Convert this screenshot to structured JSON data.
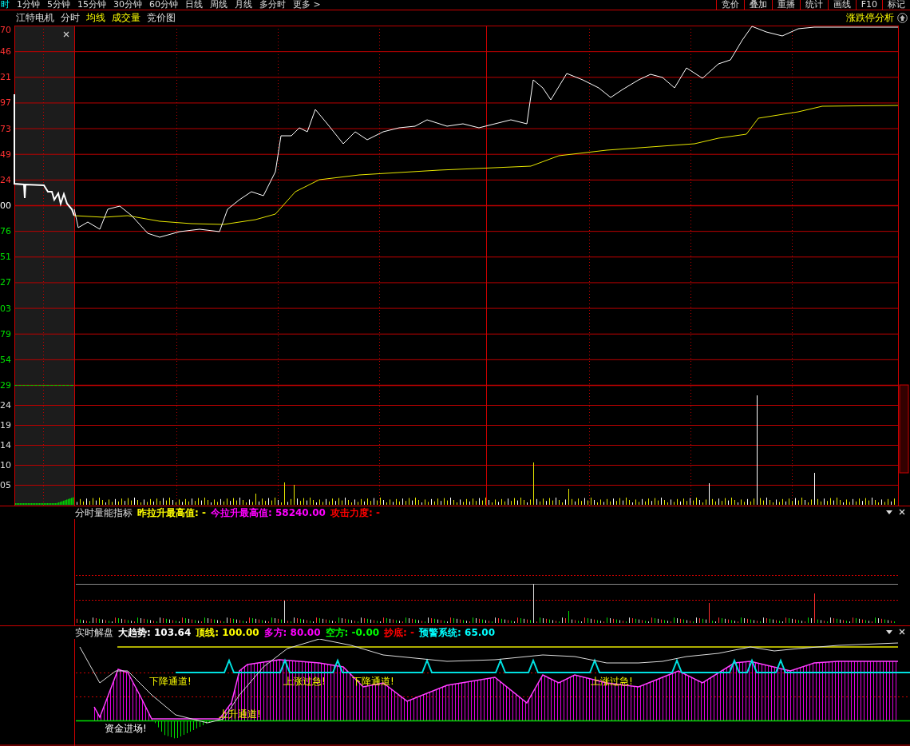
{
  "top_bar": {
    "periods": [
      {
        "label": "时",
        "selected": true
      },
      {
        "label": "1分钟",
        "selected": false
      },
      {
        "label": "5分钟",
        "selected": false
      },
      {
        "label": "15分钟",
        "selected": false
      },
      {
        "label": "30分钟",
        "selected": false
      },
      {
        "label": "60分钟",
        "selected": false
      },
      {
        "label": "日线",
        "selected": false
      },
      {
        "label": "周线",
        "selected": false
      },
      {
        "label": "月线",
        "selected": false
      },
      {
        "label": "多分时",
        "selected": false
      },
      {
        "label": "更多 >",
        "selected": false
      }
    ],
    "tools": [
      "竞价",
      "叠加",
      "重播",
      "统计",
      "画线",
      "F10",
      "标记"
    ]
  },
  "chart_header": {
    "stock": "江特电机",
    "tabs": [
      {
        "label": "分时",
        "on": false
      },
      {
        "label": "均线",
        "on": true
      },
      {
        "label": "成交量",
        "on": true
      },
      {
        "label": "竞价图",
        "on": false
      }
    ],
    "limit_analysis": "涨跌停分析"
  },
  "price_axis": [
    {
      "text": "70",
      "color": "#ff3232"
    },
    {
      "text": "46",
      "color": "#ff3232"
    },
    {
      "text": "21",
      "color": "#ff3232"
    },
    {
      "text": "97",
      "color": "#ff3232"
    },
    {
      "text": "73",
      "color": "#ff3232"
    },
    {
      "text": "49",
      "color": "#ff3232"
    },
    {
      "text": "24",
      "color": "#ff3232"
    },
    {
      "text": "00",
      "color": "#ffffff"
    },
    {
      "text": "76",
      "color": "#00e000"
    },
    {
      "text": "51",
      "color": "#00e000"
    },
    {
      "text": "27",
      "color": "#00e000"
    },
    {
      "text": "03",
      "color": "#00e000"
    },
    {
      "text": "79",
      "color": "#00e000"
    },
    {
      "text": "54",
      "color": "#00e000"
    },
    {
      "text": "29",
      "color": "#00e000"
    }
  ],
  "volume_axis": [
    "24",
    "19",
    "14",
    "10",
    "05"
  ],
  "indicator_1": {
    "title": "分时量能指标",
    "values": [
      {
        "text": "昨拉升最高值: -",
        "color": "#ffff00"
      },
      {
        "text": "今拉升最高值: 58240.00",
        "color": "#ff00ff"
      },
      {
        "text": "攻击力度: -",
        "color": "#ff0000"
      }
    ]
  },
  "indicator_2": {
    "title": "实时解盘",
    "values": [
      {
        "text": "大趋势: 103.64",
        "color": "#ffffff"
      },
      {
        "text": "顶线: 100.00",
        "color": "#ffff00"
      },
      {
        "text": "多方: 80.00",
        "color": "#ff00ff"
      },
      {
        "text": "空方: -0.00",
        "color": "#00ff00"
      },
      {
        "text": "抄底: -",
        "color": "#ff0000"
      },
      {
        "text": "预警系统: 65.00",
        "color": "#00ffff"
      }
    ],
    "signals": [
      {
        "text": "下降通道!",
        "kind": "caution"
      },
      {
        "text": "上涨过急!",
        "kind": "caution"
      },
      {
        "text": "下降通道!",
        "kind": "caution"
      },
      {
        "text": "上涨过急!",
        "kind": "caution"
      },
      {
        "text": "上升通道!",
        "kind": "caution"
      },
      {
        "text": "资金进场!",
        "kind": "inflow"
      }
    ]
  }
}
